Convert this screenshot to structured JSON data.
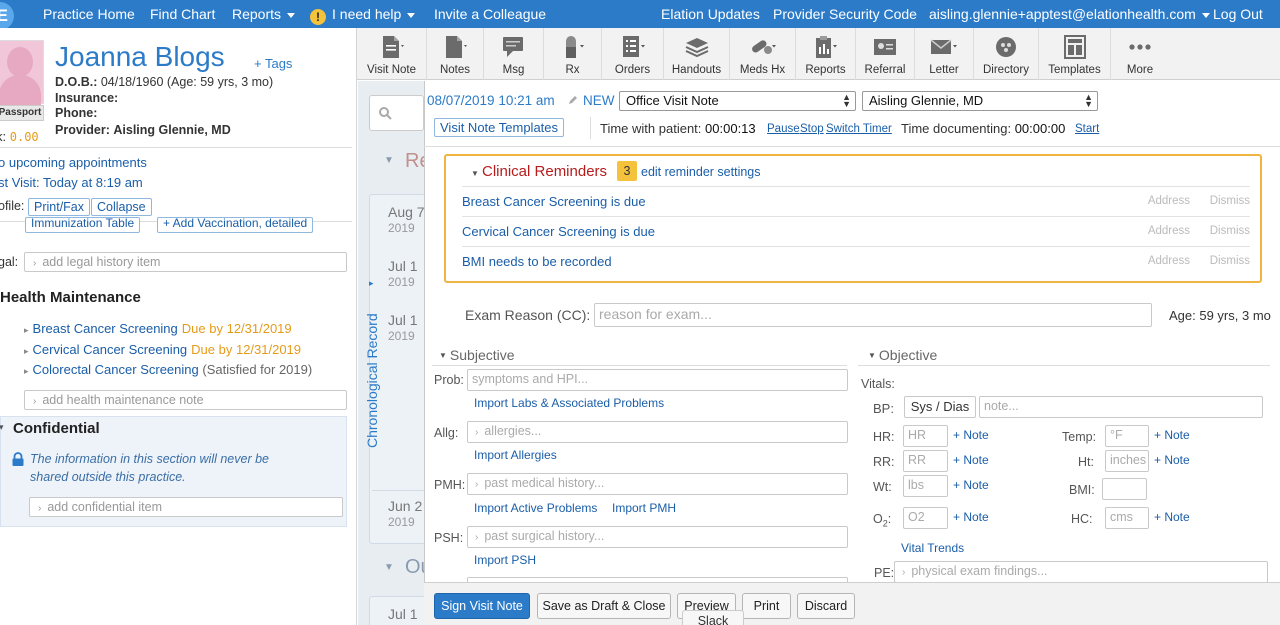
{
  "nav": {
    "logo": "E",
    "practice_home": "Practice Home",
    "find_chart": "Find Chart",
    "reports": "Reports",
    "need_help": "I need help",
    "invite": "Invite a Colleague",
    "updates": "Elation Updates",
    "security_code": "Provider Security Code",
    "user_email": "aisling.glennie+apptest@elationhealth.com",
    "logout": "Log Out"
  },
  "patient": {
    "name": "Joanna Blogs",
    "tags_link": "+ Tags",
    "passport_label": "Passport",
    "risk_label": "k:",
    "risk_value": "0.00",
    "dob_label": "D.O.B.:",
    "dob_value": "04/18/1960 (Age: 59 yrs, 3 mo)",
    "insurance_label": "Insurance:",
    "phone_label": "Phone:",
    "provider_label": "Provider:",
    "provider_value": "Aisling Glennie, MD",
    "appointments": "o upcoming appointments",
    "last_visit": "st Visit: Today at 8:19 am",
    "profile_label": "ofile:",
    "print_fax": "Print/Fax",
    "collapse": "Collapse",
    "immunization_table": "Immunization Table",
    "add_vaccination": "+ Add Vaccination, detailed",
    "legal_label": "gal:",
    "legal_placeholder": "add legal history item"
  },
  "health_maintenance": {
    "title": "Health Maintenance",
    "items": [
      {
        "name": "Breast Cancer Screening",
        "status": "Due by 12/31/2019"
      },
      {
        "name": "Cervical Cancer Screening",
        "status": "Due by 12/31/2019"
      },
      {
        "name": "Colorectal Cancer Screening",
        "status": "(Satisfied for 2019)"
      }
    ],
    "note_placeholder": "add health maintenance note"
  },
  "confidential": {
    "title": "Confidential",
    "message_line1": "The information in this section will never be",
    "message_line2": "shared outside this practice.",
    "placeholder": "add confidential item"
  },
  "toolbar": {
    "items": [
      "Visit Note",
      "Notes",
      "Msg",
      "Rx",
      "Orders",
      "Handouts",
      "Meds Hx",
      "Reports",
      "Referral",
      "Letter",
      "Directory",
      "Templates",
      "More"
    ]
  },
  "timeline": {
    "header_1": "Re",
    "header_2": "Ou",
    "chrono_label": "Chronological Record",
    "entries": [
      {
        "date": "Aug 7",
        "year": "2019"
      },
      {
        "date": "Jul 1",
        "year": "2019"
      },
      {
        "date": "Jul 1",
        "year": "2019"
      },
      {
        "date": "Jun 2",
        "year": "2019"
      },
      {
        "date": "Jul 1",
        "year": ""
      }
    ]
  },
  "note": {
    "datetime": "08/07/2019 10:21 am",
    "new_label": "NEW",
    "note_type": "Office Visit Note",
    "provider": "Aisling Glennie, MD",
    "templates_button": "Visit Note Templates",
    "time_with_patient_label": "Time with patient:",
    "time_with_patient": "00:00:13",
    "pause": "Pause",
    "stop": "Stop",
    "switch_timer": "Switch Timer",
    "time_documenting_label": "Time documenting:",
    "time_documenting": "00:00:00",
    "start": "Start"
  },
  "reminders": {
    "title": "Clinical Reminders",
    "count": "3",
    "settings_link": "edit reminder settings",
    "address": "Address",
    "dismiss": "Dismiss",
    "items": [
      "Breast Cancer Screening is due",
      "Cervical Cancer Screening is due",
      "BMI needs to be recorded"
    ]
  },
  "exam": {
    "reason_label": "Exam Reason (CC):",
    "reason_placeholder": "reason for exam...",
    "age": "Age: 59 yrs, 3 mo"
  },
  "subjective": {
    "title": "Subjective",
    "prob_label": "Prob:",
    "prob_placeholder": "symptoms and HPI...",
    "import_labs": "Import Labs & Associated Problems",
    "allg_label": "Allg:",
    "allg_placeholder": "allergies...",
    "import_allergies": "Import Allergies",
    "pmh_label": "PMH:",
    "pmh_placeholder": "past medical history...",
    "import_active": "Import Active Problems",
    "import_pmh": "Import PMH",
    "psh_label": "PSH:",
    "psh_placeholder": "past surgical history...",
    "import_psh": "Import PSH"
  },
  "objective": {
    "title": "Objective",
    "vitals_label": "Vitals:",
    "bp_label": "BP:",
    "bp_value": "Sys / Dias",
    "bp_note_placeholder": "note...",
    "hr_label": "HR:",
    "hr_placeholder": "HR",
    "rr_label": "RR:",
    "rr_placeholder": "RR",
    "wt_label": "Wt:",
    "wt_placeholder": "lbs",
    "o2_label": "O",
    "o2_sub": "2",
    "o2_colon": ":",
    "o2_placeholder": "O2",
    "temp_label": "Temp:",
    "temp_placeholder": "°F",
    "ht_label": "Ht:",
    "ht_placeholder": "inches",
    "bmi_label": "BMI:",
    "hc_label": "HC:",
    "hc_placeholder": "cms",
    "add_note": "+ Note",
    "vital_trends": "Vital Trends",
    "pe_label": "PE:",
    "pe_placeholder": "physical exam findings..."
  },
  "actions": {
    "sign": "Sign Visit Note",
    "save_draft": "Save as Draft & Close",
    "preview": "Preview",
    "print": "Print",
    "discard": "Discard",
    "slack": "Slack"
  },
  "colors": {
    "nav_blue": "#2b7bc9",
    "link_blue": "#1a5ea8",
    "reminder_red": "#b71c1c",
    "due_orange": "#e59b1a",
    "reminder_border": "#f0b541"
  }
}
